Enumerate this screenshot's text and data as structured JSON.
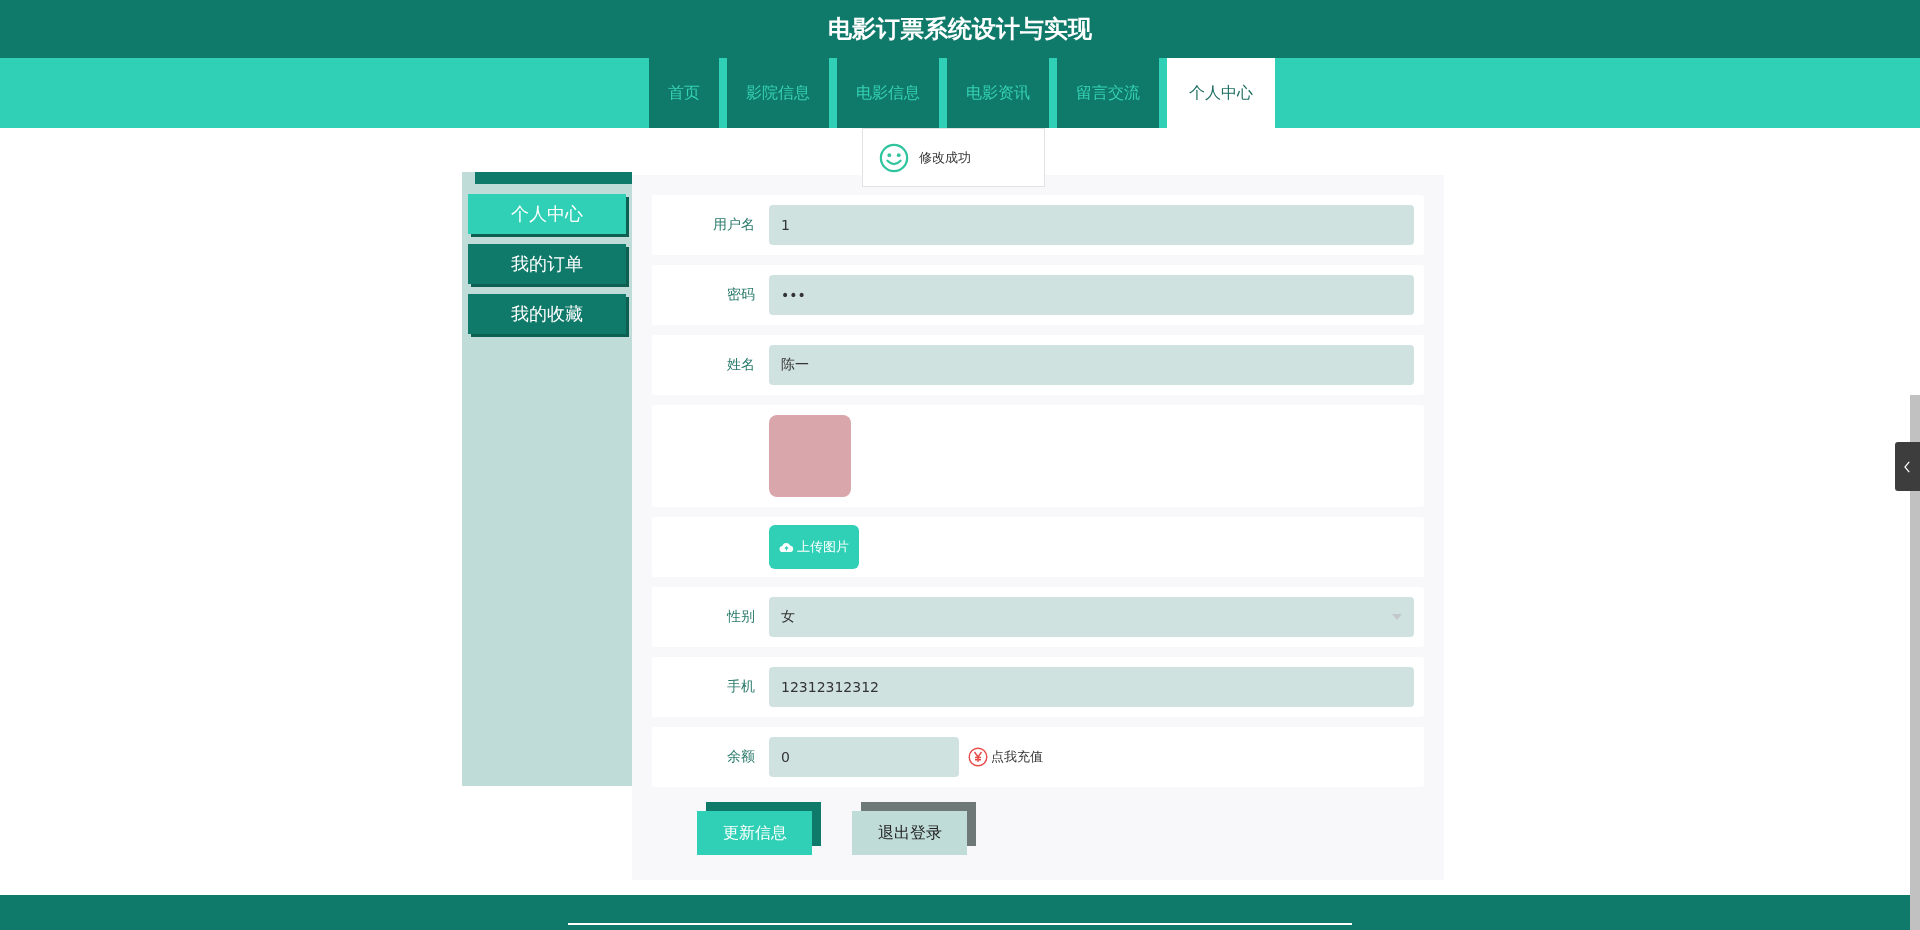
{
  "header": {
    "title": "电影订票系统设计与实现"
  },
  "nav": {
    "tabs": [
      {
        "label": "首页",
        "selected": false
      },
      {
        "label": "影院信息",
        "selected": false
      },
      {
        "label": "电影信息",
        "selected": false
      },
      {
        "label": "电影资讯",
        "selected": false
      },
      {
        "label": "留言交流",
        "selected": false
      },
      {
        "label": "个人中心",
        "selected": true
      }
    ]
  },
  "toast": {
    "message": "修改成功"
  },
  "sidebar": {
    "items": [
      {
        "label": "个人中心",
        "selected": true
      },
      {
        "label": "我的订单",
        "selected": false
      },
      {
        "label": "我的收藏",
        "selected": false
      }
    ]
  },
  "form": {
    "fields": [
      {
        "kind": "text",
        "label": "用户名",
        "value": "1"
      },
      {
        "kind": "text",
        "label": "密码",
        "value": "•••"
      },
      {
        "kind": "text",
        "label": "姓名",
        "value": "陈一"
      },
      {
        "kind": "image"
      },
      {
        "kind": "upload",
        "button": "上传图片"
      },
      {
        "kind": "select",
        "label": "性别",
        "value": "女"
      },
      {
        "kind": "text",
        "label": "手机",
        "value": "12312312312"
      },
      {
        "kind": "balance",
        "label": "余额",
        "value": "0",
        "link": "点我充值"
      }
    ],
    "buttons": [
      {
        "kind": "primary",
        "label": "更新信息"
      },
      {
        "kind": "secondary",
        "label": "退出登录"
      }
    ]
  }
}
